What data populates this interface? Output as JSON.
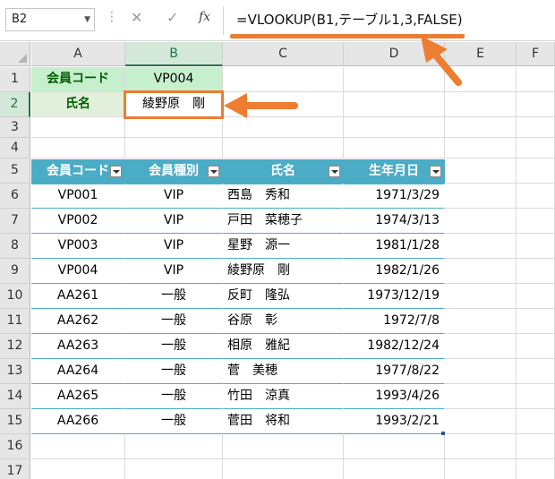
{
  "formula_bar": {
    "name_box": "B2",
    "fx_label": "fx",
    "formula": "=VLOOKUP(B1,テーブル1,3,FALSE)"
  },
  "columns": [
    "A",
    "B",
    "C",
    "D",
    "E",
    "F"
  ],
  "rows": [
    "1",
    "2",
    "3",
    "4",
    "5",
    "6",
    "7",
    "8",
    "9",
    "10",
    "11",
    "12",
    "13",
    "14",
    "15",
    "16",
    "17"
  ],
  "lookup": {
    "code_label": "会員コード",
    "code_value": "VP004",
    "name_label": "氏名",
    "name_value": "綾野原　剛"
  },
  "table": {
    "headers": [
      "会員コード",
      "会員種別",
      "氏名",
      "生年月日"
    ],
    "rows": [
      [
        "VP001",
        "VIP",
        "西島　秀和",
        "1971/3/29"
      ],
      [
        "VP002",
        "VIP",
        "戸田　菜穂子",
        "1974/3/13"
      ],
      [
        "VP003",
        "VIP",
        "星野　源一",
        "1981/1/28"
      ],
      [
        "VP004",
        "VIP",
        "綾野原　剛",
        "1982/1/26"
      ],
      [
        "AA261",
        "一般",
        "反町　隆弘",
        "1973/12/19"
      ],
      [
        "AA262",
        "一般",
        "谷原　彰",
        "1972/7/8"
      ],
      [
        "AA263",
        "一般",
        "相原　雅紀",
        "1982/12/24"
      ],
      [
        "AA264",
        "一般",
        "菅　美穂",
        "1977/8/22"
      ],
      [
        "AA265",
        "一般",
        "竹田　涼真",
        "1993/4/26"
      ],
      [
        "AA266",
        "一般",
        "菅田　将和",
        "1993/2/21"
      ]
    ]
  },
  "colors": {
    "annotation": "#ed7d31",
    "table_header": "#4bacc6",
    "lookup_fill": "#c6efce"
  }
}
